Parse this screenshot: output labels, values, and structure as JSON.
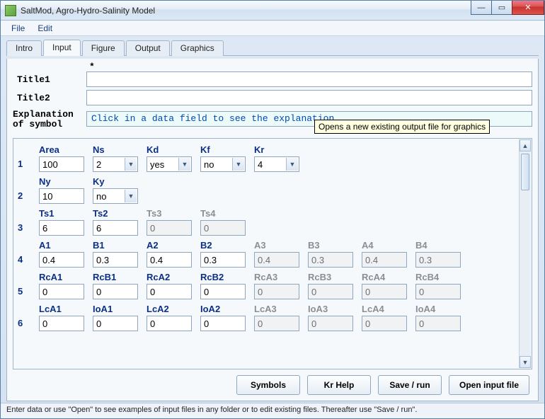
{
  "window": {
    "title": "SaltMod, Agro-Hydro-Salinity Model"
  },
  "menu": {
    "file": "File",
    "edit": "Edit"
  },
  "tabs": {
    "intro": "Intro",
    "input": "Input",
    "figure": "Figure",
    "output": "Output",
    "graphics": "Graphics"
  },
  "labels": {
    "star": "*",
    "title1": "Title1",
    "title2": "Title2",
    "explanation_line1": "Explanation",
    "explanation_line2": "of symbol"
  },
  "fields": {
    "title1": "",
    "title2": "",
    "explanation_placeholder": "Click in a data field to see the explanation"
  },
  "tooltip": "Opens a new existing output file for graphics",
  "grid": {
    "r1": {
      "num": "1",
      "Area": {
        "l": "Area",
        "v": "100"
      },
      "Ns": {
        "l": "Ns",
        "v": "2"
      },
      "Kd": {
        "l": "Kd",
        "v": "yes"
      },
      "Kf": {
        "l": "Kf",
        "v": "no"
      },
      "Kr": {
        "l": "Kr",
        "v": "4"
      }
    },
    "r2": {
      "num": "2",
      "Ny": {
        "l": "Ny",
        "v": "10"
      },
      "Ky": {
        "l": "Ky",
        "v": "no"
      }
    },
    "r3": {
      "num": "3",
      "Ts1": {
        "l": "Ts1",
        "v": "6"
      },
      "Ts2": {
        "l": "Ts2",
        "v": "6"
      },
      "Ts3": {
        "l": "Ts3",
        "v": "0"
      },
      "Ts4": {
        "l": "Ts4",
        "v": "0"
      }
    },
    "r4": {
      "num": "4",
      "A1": {
        "l": "A1",
        "v": "0.4"
      },
      "B1": {
        "l": "B1",
        "v": "0.3"
      },
      "A2": {
        "l": "A2",
        "v": "0.4"
      },
      "B2": {
        "l": "B2",
        "v": "0.3"
      },
      "A3": {
        "l": "A3",
        "v": "0.4"
      },
      "B3": {
        "l": "B3",
        "v": "0.3"
      },
      "A4": {
        "l": "A4",
        "v": "0.4"
      },
      "B4": {
        "l": "B4",
        "v": "0.3"
      }
    },
    "r5": {
      "num": "5",
      "RcA1": {
        "l": "RcA1",
        "v": "0"
      },
      "RcB1": {
        "l": "RcB1",
        "v": "0"
      },
      "RcA2": {
        "l": "RcA2",
        "v": "0"
      },
      "RcB2": {
        "l": "RcB2",
        "v": "0"
      },
      "RcA3": {
        "l": "RcA3",
        "v": "0"
      },
      "RcB3": {
        "l": "RcB3",
        "v": "0"
      },
      "RcA4": {
        "l": "RcA4",
        "v": "0"
      },
      "RcB4": {
        "l": "RcB4",
        "v": "0"
      }
    },
    "r6": {
      "num": "6",
      "LcA1": {
        "l": "LcA1",
        "v": "0"
      },
      "IoA1": {
        "l": "IoA1",
        "v": "0"
      },
      "LcA2": {
        "l": "LcA2",
        "v": "0"
      },
      "IoA2": {
        "l": "IoA2",
        "v": "0"
      },
      "LcA3": {
        "l": "LcA3",
        "v": "0"
      },
      "IoA3": {
        "l": "IoA3",
        "v": "0"
      },
      "LcA4": {
        "l": "LcA4",
        "v": "0"
      },
      "IoA4": {
        "l": "IoA4",
        "v": "0"
      }
    }
  },
  "buttons": {
    "symbols": "Symbols",
    "krhelp": "Kr Help",
    "saverun": "Save / run",
    "openinput": "Open input file"
  },
  "statusbar": "Enter data or use \"Open\" to see examples of input files in any folder or to edit existing files. Thereafter use \"Save / run\"."
}
